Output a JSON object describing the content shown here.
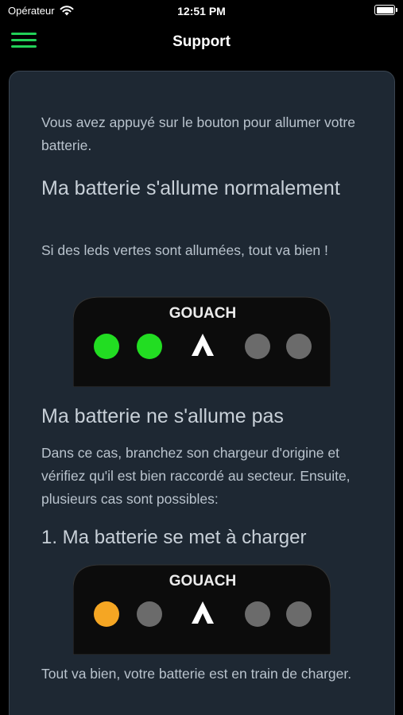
{
  "status_bar": {
    "carrier": "Opérateur",
    "time": "12:51 PM"
  },
  "nav": {
    "title": "Support"
  },
  "content": {
    "intro": "Vous avez appuyé sur le bouton pour allumer votre batterie.",
    "heading_on": "Ma batterie s'allume normalement",
    "text_on": "Si des leds vertes sont allumées, tout va bien !",
    "device_brand": "GOUACH",
    "heading_off": "Ma batterie ne s'allume pas",
    "text_off": "Dans ce cas, branchez son chargeur d'origine et vérifiez qu'il est bien raccordé au secteur. Ensuite, plusieurs cas sont possibles:",
    "case1_heading": "1. Ma batterie se met à charger",
    "case1_text": "Tout va bien, votre batterie est en train de charger."
  },
  "device_normal": {
    "leds": [
      "#22dd22",
      "#22dd22",
      "logo",
      "#6b6b6b",
      "#6b6b6b"
    ]
  },
  "device_charging": {
    "leds": [
      "#f5a623",
      "#6b6b6b",
      "logo",
      "#6b6b6b",
      "#6b6b6b"
    ]
  },
  "colors": {
    "accent": "#22d158",
    "card_bg": "#1e2833"
  }
}
